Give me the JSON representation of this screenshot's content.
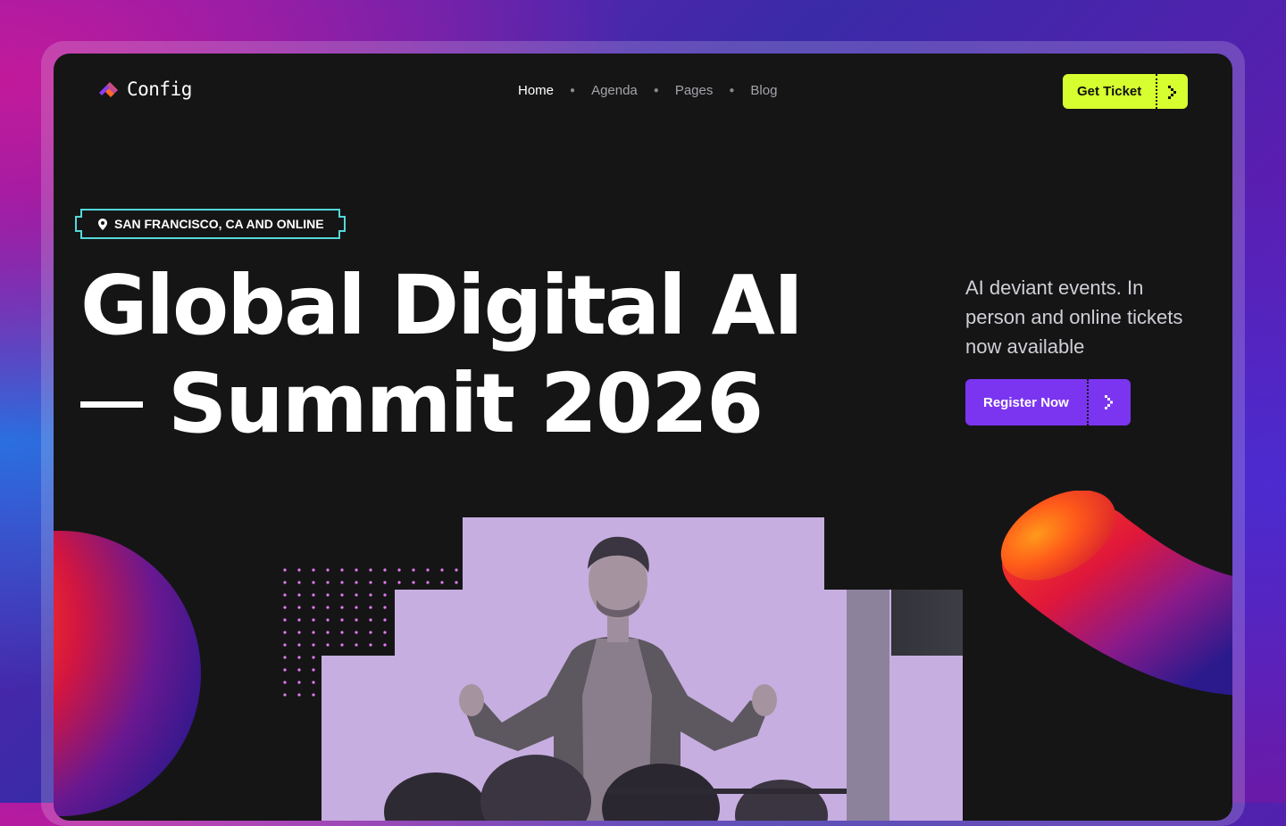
{
  "brand": {
    "name": "Config"
  },
  "nav": {
    "items": [
      {
        "label": "Home",
        "active": true
      },
      {
        "label": "Agenda",
        "active": false
      },
      {
        "label": "Pages",
        "active": false
      },
      {
        "label": "Blog",
        "active": false
      }
    ]
  },
  "header": {
    "ticket_label": "Get Ticket"
  },
  "hero": {
    "location": "SAN FRANCISCO, CA AND ONLINE",
    "title_line1": "Global Digital AI",
    "title_line2": "Summit 2026",
    "tagline": "AI deviant events. In person and online tickets now available",
    "register_label": "Register Now"
  },
  "colors": {
    "accent_lime": "#d7ff2f",
    "accent_purple": "#7b35f0",
    "badge_border": "#55d8d8",
    "background": "#151516"
  },
  "icons": {
    "logo": "config-logo-icon",
    "ticket_arrow": "chevron-right-icon",
    "location": "map-pin-icon",
    "register_arrow": "chevron-right-icon"
  }
}
